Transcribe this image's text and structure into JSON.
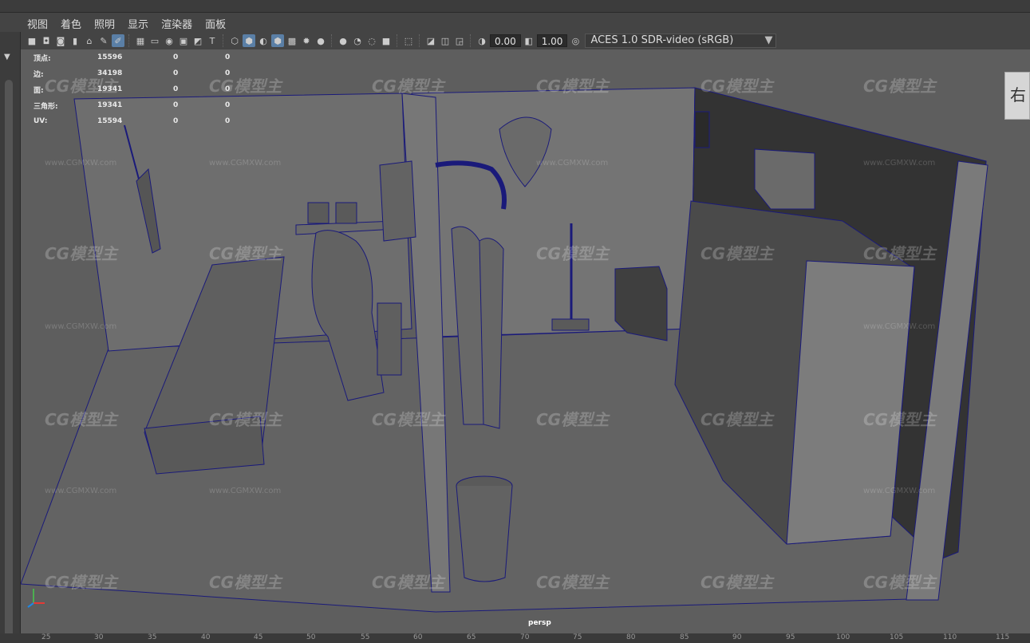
{
  "menu": [
    "视图",
    "着色",
    "照明",
    "显示",
    "渲染器",
    "面板"
  ],
  "toolbar": {
    "exposure": "0.00",
    "gamma": "1.00",
    "color_space": "ACES 1.0 SDR-video (sRGB)",
    "icons": [
      "camera-icon",
      "camera-lock-icon",
      "bookmark-icon",
      "image-plane-icon",
      "grid-icon",
      "film-gate-icon",
      "resolution-gate-icon",
      "gate-mask-icon",
      "field-chart-icon",
      "safe-action-icon",
      "safe-title-icon",
      "wireframe-icon",
      "smooth-shade-icon",
      "default-material-icon",
      "textured-icon",
      "use-all-lights-icon",
      "shadows-icon",
      "screen-space-ao-icon",
      "motion-blur-icon",
      "multisample-aa-icon",
      "depth-of-field-icon",
      "isolate-select-icon",
      "xray-icon",
      "xray-joints-icon",
      "backface-icon",
      "exposure-icon",
      "gamma-icon",
      "color-management-icon"
    ]
  },
  "hud": {
    "rows": [
      {
        "label": "顶点:",
        "v1": "15596",
        "v2": "0",
        "v3": "0"
      },
      {
        "label": "边:",
        "v1": "34198",
        "v2": "0",
        "v3": "0"
      },
      {
        "label": "面:",
        "v1": "19341",
        "v2": "0",
        "v3": "0"
      },
      {
        "label": "三角形:",
        "v1": "19341",
        "v2": "0",
        "v3": "0"
      },
      {
        "label": "UV:",
        "v1": "15594",
        "v2": "0",
        "v3": "0"
      }
    ]
  },
  "viewport": {
    "camera": "persp",
    "viewcube_label": "右",
    "watermark": "CG模型主",
    "watermark_url": "www.CGMXW.com"
  },
  "timeline": {
    "ticks": [
      "25",
      "30",
      "35",
      "40",
      "45",
      "50",
      "55",
      "60",
      "65",
      "70",
      "75",
      "80",
      "85",
      "90",
      "95",
      "100",
      "105",
      "110",
      "115"
    ]
  }
}
